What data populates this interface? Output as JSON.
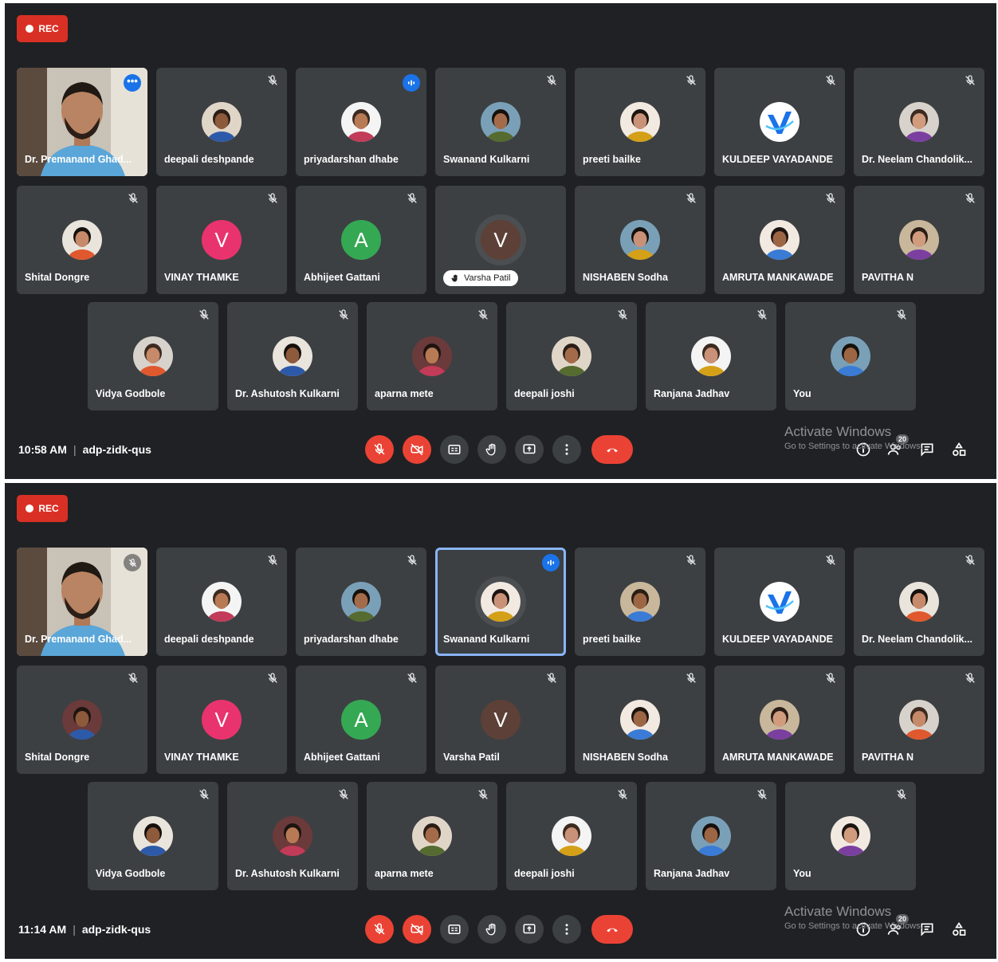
{
  "screenshots": [
    {
      "rec_label": "REC",
      "time": "10:58 AM",
      "meeting_code": "adp-zidk-qus",
      "participants_count": "20",
      "watermark": {
        "line1": "Activate Windows",
        "line2": "Go to Settings to activate Windows."
      },
      "raised_hand_label": "Varsha Patil",
      "tiles": [
        {
          "name": "Dr. Premanand Ghad...",
          "kind": "video",
          "indicator": "more"
        },
        {
          "name": "deepali deshpande",
          "kind": "photo",
          "indicator": "muted"
        },
        {
          "name": "priyadarshan dhabe",
          "kind": "photo",
          "indicator": "speaking"
        },
        {
          "name": "Swanand Kulkarni",
          "kind": "photo",
          "indicator": "muted"
        },
        {
          "name": "preeti bailke",
          "kind": "photo",
          "indicator": "muted"
        },
        {
          "name": "KULDEEP VAYADANDE",
          "kind": "logo",
          "indicator": "muted"
        },
        {
          "name": "Dr. Neelam Chandolik...",
          "kind": "photo",
          "indicator": "muted"
        },
        {
          "name": "Shital Dongre",
          "kind": "photo",
          "indicator": "muted"
        },
        {
          "name": "VINAY THAMKE",
          "kind": "letter",
          "letter": "V",
          "color": "#e8336f",
          "indicator": "muted"
        },
        {
          "name": "Abhijeet Gattani",
          "kind": "letter",
          "letter": "A",
          "color": "#34a853",
          "indicator": "muted"
        },
        {
          "name": "Varsha Patil",
          "kind": "letter",
          "letter": "V",
          "color": "#5d4037",
          "indicator": "none",
          "hand": true
        },
        {
          "name": "NISHABEN Sodha",
          "kind": "photo",
          "indicator": "muted"
        },
        {
          "name": "AMRUTA MANKAWADE",
          "kind": "photo",
          "indicator": "muted"
        },
        {
          "name": "PAVITHA N",
          "kind": "photo",
          "indicator": "muted"
        },
        {
          "name": "Vidya Godbole",
          "kind": "photo",
          "indicator": "muted"
        },
        {
          "name": "Dr. Ashutosh Kulkarni",
          "kind": "photo",
          "indicator": "muted"
        },
        {
          "name": "aparna mete",
          "kind": "photo",
          "indicator": "muted"
        },
        {
          "name": "deepali joshi",
          "kind": "photo",
          "indicator": "muted"
        },
        {
          "name": "Ranjana Jadhav",
          "kind": "photo",
          "indicator": "muted"
        },
        {
          "name": "You",
          "kind": "photo",
          "indicator": "muted"
        }
      ]
    },
    {
      "rec_label": "REC",
      "time": "11:14 AM",
      "meeting_code": "adp-zidk-qus",
      "participants_count": "20",
      "watermark": {
        "line1": "Activate Windows",
        "line2": "Go to Settings to activate Windows."
      },
      "tiles": [
        {
          "name": "Dr. Premanand Ghad...",
          "kind": "video",
          "indicator": "muted-round"
        },
        {
          "name": "deepali deshpande",
          "kind": "photo",
          "indicator": "muted"
        },
        {
          "name": "priyadarshan dhabe",
          "kind": "photo",
          "indicator": "muted"
        },
        {
          "name": "Swanand Kulkarni",
          "kind": "photo",
          "indicator": "speaking",
          "highlight": true
        },
        {
          "name": "preeti bailke",
          "kind": "photo",
          "indicator": "muted"
        },
        {
          "name": "KULDEEP VAYADANDE",
          "kind": "logo",
          "indicator": "muted"
        },
        {
          "name": "Dr. Neelam Chandolik...",
          "kind": "photo",
          "indicator": "muted"
        },
        {
          "name": "Shital Dongre",
          "kind": "photo",
          "indicator": "muted"
        },
        {
          "name": "VINAY THAMKE",
          "kind": "letter",
          "letter": "V",
          "color": "#e8336f",
          "indicator": "muted"
        },
        {
          "name": "Abhijeet Gattani",
          "kind": "letter",
          "letter": "A",
          "color": "#34a853",
          "indicator": "muted"
        },
        {
          "name": "Varsha Patil",
          "kind": "letter",
          "letter": "V",
          "color": "#5d4037",
          "indicator": "muted"
        },
        {
          "name": "NISHABEN Sodha",
          "kind": "photo",
          "indicator": "muted"
        },
        {
          "name": "AMRUTA MANKAWADE",
          "kind": "photo",
          "indicator": "muted"
        },
        {
          "name": "PAVITHA N",
          "kind": "photo",
          "indicator": "muted"
        },
        {
          "name": "Vidya Godbole",
          "kind": "photo",
          "indicator": "muted"
        },
        {
          "name": "Dr. Ashutosh Kulkarni",
          "kind": "photo",
          "indicator": "muted"
        },
        {
          "name": "aparna mete",
          "kind": "photo",
          "indicator": "muted"
        },
        {
          "name": "deepali joshi",
          "kind": "photo",
          "indicator": "muted"
        },
        {
          "name": "Ranjana Jadhav",
          "kind": "photo",
          "indicator": "muted"
        },
        {
          "name": "You",
          "kind": "photo",
          "indicator": "muted"
        }
      ]
    }
  ],
  "controls": [
    {
      "icon": "mic-off-icon",
      "style": "red"
    },
    {
      "icon": "camera-off-icon",
      "style": "red"
    },
    {
      "icon": "captions-icon",
      "style": "dark"
    },
    {
      "icon": "raise-hand-icon",
      "style": "dark"
    },
    {
      "icon": "present-screen-icon",
      "style": "dark"
    },
    {
      "icon": "more-options-icon",
      "style": "dark"
    },
    {
      "icon": "end-call-icon",
      "style": "end"
    }
  ],
  "right_icons": [
    "info-icon",
    "people-icon",
    "chat-icon",
    "activities-icon"
  ],
  "colors": {
    "meet_bg": "#202124",
    "tile_bg": "#3c4043",
    "red": "#ea4335",
    "blue": "#1a73e8",
    "highlight": "#8ab4f8"
  }
}
